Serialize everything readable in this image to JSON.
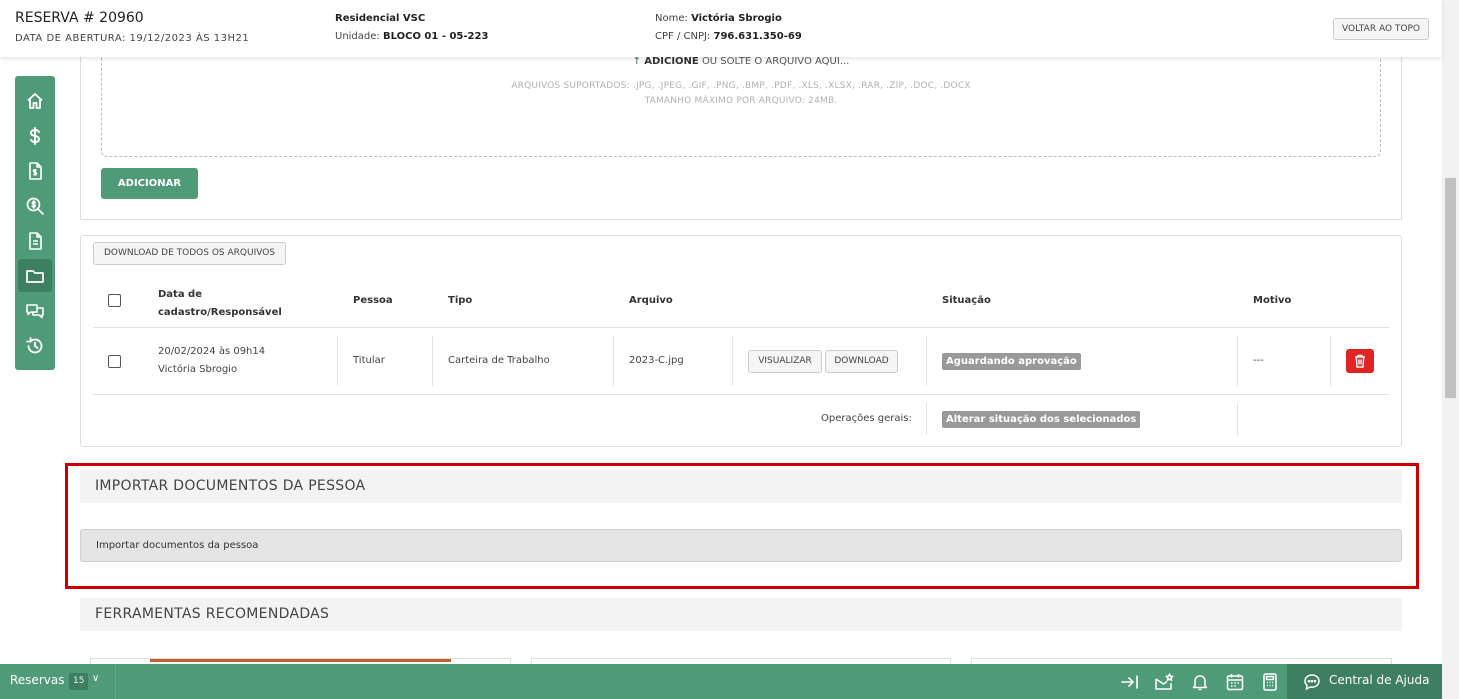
{
  "header": {
    "reservation_title": "RESERVA # 20960",
    "opening_date": "DATA DE ABERTURA: 19/12/2023 ÀS 13H21",
    "condominium": "Residencial VSC",
    "unit_label": "Unidade:",
    "unit_value": "BLOCO 01 - 05-223",
    "name_label": "Nome:",
    "name_value": "Victória Sbrogio",
    "doc_label": "CPF / CNPJ:",
    "doc_value": "796.631.350-69",
    "back_to_top": "VOLTAR AO TOPO"
  },
  "sidebar": {
    "items": [
      {
        "icon": "home-icon"
      },
      {
        "icon": "dollar-icon"
      },
      {
        "icon": "invoice-icon"
      },
      {
        "icon": "search-money-icon"
      },
      {
        "icon": "document-icon"
      },
      {
        "icon": "folder-icon",
        "active": true
      },
      {
        "icon": "chat-icon"
      },
      {
        "icon": "history-icon"
      }
    ]
  },
  "upload": {
    "add_bold": "ADICIONE",
    "add_rest": "OU SOLTE O ARQUIVO AQUI...",
    "supported": "ARQUIVOS SUPORTADOS: .JPG, .JPEG, .GIF, .PNG, .BMP, .PDF, .XLS, .XLSX, .RAR, .ZIP, .DOC, .DOCX",
    "max_size": "TAMANHO MÁXIMO POR ARQUIVO: 24MB.",
    "add_button": "ADICIONAR"
  },
  "files": {
    "download_all": "DOWNLOAD DE TODOS OS ARQUIVOS",
    "columns": {
      "date_line1": "Data de",
      "date_line2": "cadastro/Responsável",
      "person": "Pessoa",
      "type": "Tipo",
      "file": "Arquivo",
      "status": "Situação",
      "reason": "Motivo"
    },
    "rows": [
      {
        "date": "20/02/2024 às 09h14",
        "responsible": "Victória Sbrogio",
        "person": "Titular",
        "type": "Carteira de Trabalho",
        "file": "2023-C.jpg",
        "view_button": "VISUALIZAR",
        "download_button": "DOWNLOAD",
        "status": "Aguardando aprovação",
        "reason": "---"
      }
    ],
    "general_ops_label": "Operações gerais:",
    "change_status": "Alterar situação dos selecionados"
  },
  "import_section": {
    "title": "IMPORTAR DOCUMENTOS DA PESSOA",
    "bar_label": "Importar documentos da pessoa"
  },
  "tools_section": {
    "title": "FERRAMENTAS RECOMENDADAS"
  },
  "bottom_bar": {
    "reservations_label": "Reservas",
    "reservations_count": "15",
    "help_label": "Central de Ajuda"
  },
  "colors": {
    "brand_green": "#4f9a77",
    "brand_green_dark": "#3e7f61",
    "delete_red": "#e02424",
    "highlight_red": "#cc0000"
  }
}
